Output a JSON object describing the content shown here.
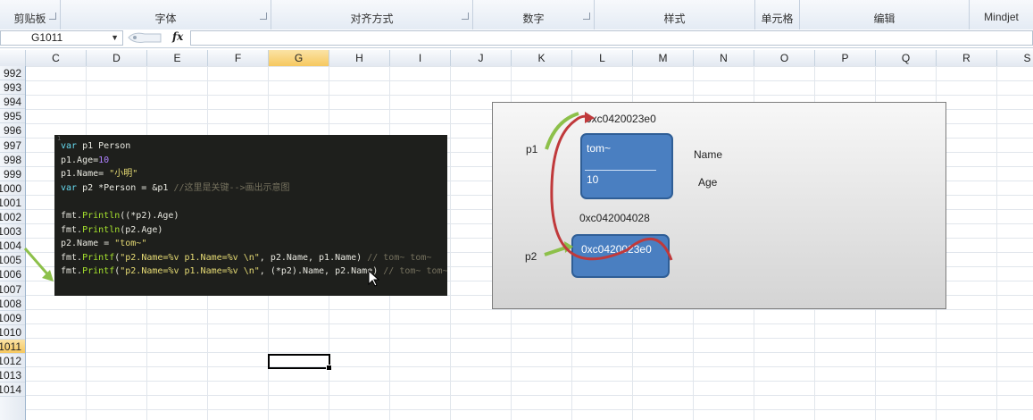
{
  "ribbon": {
    "groups": [
      {
        "label": "剪贴板",
        "launcher": true
      },
      {
        "label": "字体",
        "launcher": true
      },
      {
        "label": "对齐方式",
        "launcher": true
      },
      {
        "label": "数字",
        "launcher": true
      },
      {
        "label": "样式",
        "launcher": false
      },
      {
        "label": "单元格",
        "launcher": false
      },
      {
        "label": "编辑",
        "launcher": false
      },
      {
        "label": "Mindjet",
        "launcher": false
      }
    ]
  },
  "formula_bar": {
    "name_box": "G1011",
    "fx_label": "fx",
    "formula": ""
  },
  "columns": [
    "C",
    "D",
    "E",
    "F",
    "G",
    "H",
    "I",
    "J",
    "K",
    "L",
    "M",
    "N",
    "O",
    "P",
    "Q",
    "R",
    "S"
  ],
  "selected_column": "G",
  "rows": [
    "992",
    "993",
    "994",
    "995",
    "996",
    "997",
    "998",
    "999",
    "1000",
    "1001",
    "1002",
    "1003",
    "1004",
    "1005",
    "1006",
    "1007",
    "1008",
    "1009",
    "1010",
    "1011",
    "1012",
    "1013",
    "1014"
  ],
  "selected_row": "1011",
  "code": {
    "lines": [
      "var p1 Person",
      "p1.Age=10",
      "p1.Name= \"小明\"",
      "var p2 *Person = &p1 //这里是关键-->画出示意图",
      "",
      "fmt.Println((*p2).Age)",
      "fmt.Println(p2.Age)",
      "p2.Name = \"tom~\"",
      "fmt.Printf(\"p2.Name=%v p1.Name=%v \\n\", p2.Name, p1.Name) // tom~ tom~",
      "fmt.Printf(\"p2.Name=%v p1.Name=%v \\n\", (*p2).Name, p2.Name) // tom~ tom~"
    ]
  },
  "diagram": {
    "p1_label": "p1",
    "p2_label": "p2",
    "p1_address": "0xc0420023e0",
    "p2_address": "0xc042004028",
    "p1_box": {
      "name_value": "tom~",
      "age_value": "10"
    },
    "p2_box_value": "0xc0420023e0",
    "field_name_label": "Name",
    "field_age_label": "Age",
    "colors": {
      "box_fill": "#4a7fc1",
      "arrow_green": "#8dc04a",
      "arrow_red": "#c0393b"
    }
  }
}
